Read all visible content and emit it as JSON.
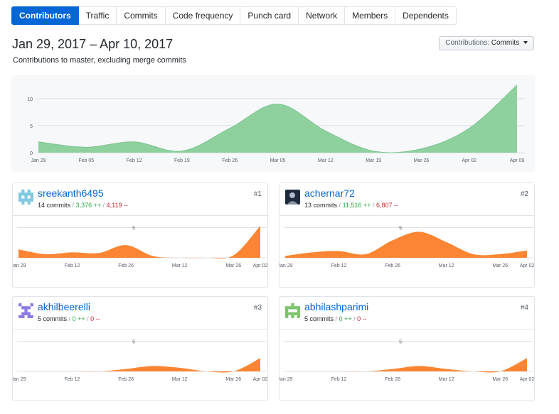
{
  "tabs": [
    {
      "label": "Contributors",
      "active": true
    },
    {
      "label": "Traffic",
      "active": false
    },
    {
      "label": "Commits",
      "active": false
    },
    {
      "label": "Code frequency",
      "active": false
    },
    {
      "label": "Punch card",
      "active": false
    },
    {
      "label": "Network",
      "active": false
    },
    {
      "label": "Members",
      "active": false
    },
    {
      "label": "Dependents",
      "active": false
    }
  ],
  "header": {
    "range": "Jan 29, 2017 – Apr 10, 2017",
    "subtitle": "Contributions to master, excluding merge commits",
    "select_label": "Contributions:",
    "select_value": "Commits"
  },
  "colors": {
    "main_fill": "#8fd19e",
    "main_stroke": "#7cc48f",
    "card_fill": "#fb8532",
    "grid": "#dde0e4",
    "tick": "#586069"
  },
  "chart_data": [
    {
      "type": "area",
      "chart": "all-contributors",
      "x": [
        "Jan 29",
        "Feb 05",
        "Feb 12",
        "Feb 19",
        "Feb 26",
        "Mar 05",
        "Mar 12",
        "Mar 19",
        "Mar 26",
        "Apr 02",
        "Apr 09"
      ],
      "values": [
        2,
        1,
        2,
        0.3,
        4.5,
        9,
        4,
        0.3,
        0.7,
        4.5,
        12.5
      ],
      "yticks": [
        0,
        5,
        10
      ],
      "ylim": [
        0,
        13
      ],
      "xlabel": "",
      "ylabel": "",
      "grid": true
    },
    {
      "type": "area",
      "chart": "contributor-1",
      "name": "sreekanth6495",
      "rank": "#1",
      "commits": "14 commits",
      "additions": "3,376 ++",
      "deletions": "4,119 --",
      "avatar_colors": [
        "#7fc8e0",
        "#ffffff"
      ],
      "x": [
        "Jan 29",
        "Feb 05",
        "Feb 12",
        "Feb 19",
        "Feb 26",
        "Mar 05",
        "Mar 12",
        "Mar 19",
        "Mar 26",
        "Apr 02"
      ],
      "xticks": [
        "Jan 29",
        "Feb 12",
        "Feb 26",
        "Mar 12",
        "Mar 26",
        "Apr 02"
      ],
      "values": [
        1.4,
        0.6,
        0.9,
        0.8,
        2.1,
        0.3,
        0,
        0,
        0.4,
        5.3
      ],
      "yticks": [
        5
      ],
      "ylim": [
        0,
        6
      ]
    },
    {
      "type": "area",
      "chart": "contributor-2",
      "name": "achernar72",
      "rank": "#2",
      "commits": "13 commits",
      "additions": "11,516 ++",
      "deletions": "6,807 --",
      "avatar_colors": [
        "#1f2a3c",
        "#c9d4e4"
      ],
      "x": [
        "Jan 29",
        "Feb 05",
        "Feb 12",
        "Feb 19",
        "Feb 26",
        "Mar 05",
        "Mar 12",
        "Mar 19",
        "Mar 26",
        "Apr 02"
      ],
      "xticks": [
        "Jan 29",
        "Feb 12",
        "Feb 26",
        "Mar 12",
        "Mar 26",
        "Apr 02"
      ],
      "values": [
        0.3,
        0.9,
        1.1,
        0.6,
        2.9,
        4.3,
        2.6,
        0.6,
        0.6,
        1.2
      ],
      "yticks": [
        5
      ],
      "ylim": [
        0,
        6
      ]
    },
    {
      "type": "area",
      "chart": "contributor-3",
      "name": "akhilbeerelli",
      "rank": "#3",
      "commits": "5 commits",
      "additions": "0 ++",
      "deletions": "0 --",
      "avatar_colors": [
        "#8a7ae6",
        "#ffffff"
      ],
      "x": [
        "Jan 29",
        "Feb 05",
        "Feb 12",
        "Feb 19",
        "Feb 26",
        "Mar 05",
        "Mar 12",
        "Mar 19",
        "Mar 26",
        "Apr 02"
      ],
      "xticks": [
        "Jan 29",
        "Feb 12",
        "Feb 26",
        "Mar 12",
        "Mar 26",
        "Apr 02"
      ],
      "values": [
        0,
        0,
        0,
        0,
        0.4,
        0.9,
        0.6,
        0,
        0,
        2.2
      ],
      "yticks": [
        5
      ],
      "ylim": [
        0,
        6
      ]
    },
    {
      "type": "area",
      "chart": "contributor-4",
      "name": "abhilashparimi",
      "rank": "#4",
      "commits": "5 commits",
      "additions": "0 ++",
      "deletions": "0 --",
      "avatar_colors": [
        "#7cc56a",
        "#ffffff"
      ],
      "x": [
        "Jan 29",
        "Feb 05",
        "Feb 12",
        "Feb 19",
        "Feb 26",
        "Mar 05",
        "Mar 12",
        "Mar 19",
        "Mar 26",
        "Apr 02"
      ],
      "xticks": [
        "Jan 29",
        "Feb 12",
        "Feb 26",
        "Mar 12",
        "Mar 26",
        "Apr 02"
      ],
      "values": [
        0,
        0,
        0,
        0,
        0.4,
        0.9,
        0.4,
        0,
        0,
        2.2
      ],
      "yticks": [
        5
      ],
      "ylim": [
        0,
        6
      ]
    }
  ]
}
